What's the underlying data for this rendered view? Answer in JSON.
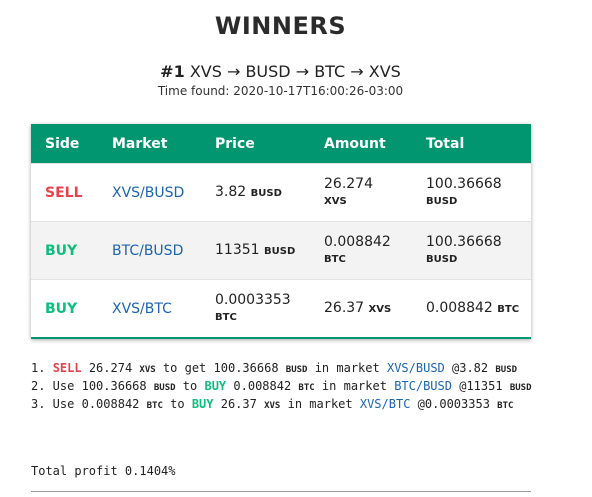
{
  "page": {
    "title": "WINNERS",
    "rank": "#1",
    "route": "XVS → BUSD → BTC → XVS",
    "time_found": "Time found: 2020-10-17T16:00:26-03:00"
  },
  "table": {
    "headers": [
      "Side",
      "Market",
      "Price",
      "Amount",
      "Total"
    ],
    "rows": [
      {
        "side": "SELL",
        "market": "XVS/BUSD",
        "price": "3.82",
        "price_unit": "BUSD",
        "amount": "26.274",
        "amount_unit": "XVS",
        "total": "100.36668",
        "total_unit": "BUSD"
      },
      {
        "side": "BUY",
        "market": "BTC/BUSD",
        "price": "11351",
        "price_unit": "BUSD",
        "amount": "0.008842",
        "amount_unit": "BTC",
        "total": "100.36668",
        "total_unit": "BUSD"
      },
      {
        "side": "BUY",
        "market": "XVS/BTC",
        "price": "0.0003353",
        "price_unit": "BTC",
        "amount": "26.37",
        "amount_unit": "XVS",
        "total": "0.008842",
        "total_unit": "BTC"
      }
    ]
  },
  "steps": [
    {
      "n": "1.",
      "action": "SELL",
      "amount": "26.274",
      "unit": "XVS",
      "mid": "to get",
      "result": "100.36668",
      "result_unit": "BUSD",
      "market_text": "in market",
      "market": "XVS/BUSD",
      "price": "@3.82",
      "price_unit": "BUSD"
    },
    {
      "n": "2. Use",
      "amount": "100.36668",
      "unit": "BUSD",
      "mid": "to",
      "action": "BUY",
      "result": "0.008842",
      "result_unit": "BTC",
      "market_text": "in market",
      "market": "BTC/BUSD",
      "price": "@11351",
      "price_unit": "BUSD"
    },
    {
      "n": "3. Use",
      "amount": "0.008842",
      "unit": "BTC",
      "mid": "to",
      "action": "BUY",
      "result": "26.37",
      "result_unit": "XVS",
      "market_text": "in market",
      "market": "XVS/BTC",
      "price": "@0.0003353",
      "price_unit": "BTC"
    }
  ],
  "total_profit": "Total profit 0.1404%",
  "colors": {
    "header": "#019670",
    "sell": "#e8424e",
    "buy": "#0dbf7f",
    "link": "#1a64b4"
  }
}
